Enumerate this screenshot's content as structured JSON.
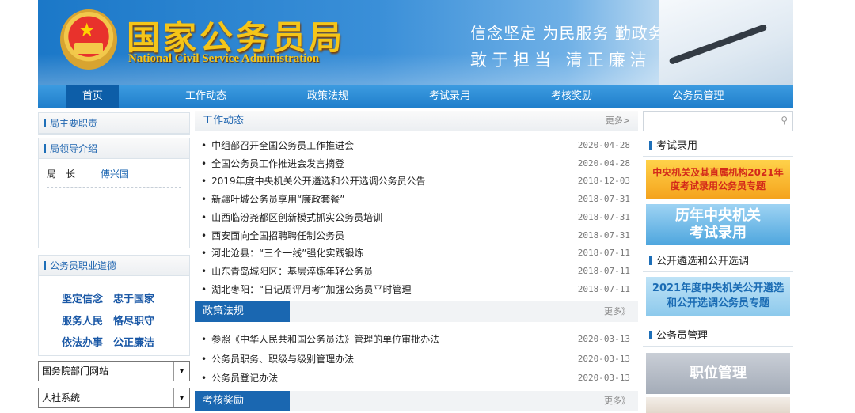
{
  "header": {
    "title": "国家公务员局",
    "subtitle": "National Civil Service Administration",
    "slogan_line1": "信念坚定 为民服务 勤政务实",
    "slogan_line2": "敢于担当  清正廉洁"
  },
  "nav": {
    "items": [
      {
        "label": "首页"
      },
      {
        "label": "工作动态"
      },
      {
        "label": "政策法规"
      },
      {
        "label": "考试录用"
      },
      {
        "label": "考核奖励"
      },
      {
        "label": "公务员管理"
      }
    ]
  },
  "left": {
    "duties_title": "局主要职责",
    "leaders_title": "局领导介绍",
    "leader_role": "局　长",
    "leader_name": "傅兴国",
    "ethics_title": "公务员职业道德",
    "ethics": [
      "坚定信念",
      "忠于国家",
      "服务人民",
      "恪尽职守",
      "依法办事",
      "公正廉洁"
    ],
    "select1": "国务院部门网站",
    "select2": "人社系统"
  },
  "work_news": {
    "title": "工作动态",
    "more": "更多>",
    "items": [
      {
        "title": "中组部召开全国公务员工作推进会",
        "date": "2020-04-28"
      },
      {
        "title": "全国公务员工作推进会发言摘登",
        "date": "2020-04-28"
      },
      {
        "title": "2019年度中央机关公开遴选和公开选调公务员公告",
        "date": "2018-12-03"
      },
      {
        "title": "新疆叶城公务员享用“廉政套餐”",
        "date": "2018-07-31"
      },
      {
        "title": "山西临汾尧都区创新模式抓实公务员培训",
        "date": "2018-07-31"
      },
      {
        "title": "西安面向全国招聘聘任制公务员",
        "date": "2018-07-31"
      },
      {
        "title": "河北沧县：“三个一线”强化实践锻炼",
        "date": "2018-07-11"
      },
      {
        "title": "山东青岛城阳区：基层淬炼年轻公务员",
        "date": "2018-07-11"
      },
      {
        "title": "湖北枣阳：“日记周评月考”加强公务员平时管理",
        "date": "2018-07-11"
      }
    ]
  },
  "policy": {
    "title": "政策法规",
    "more": "更多》",
    "items": [
      {
        "title": "参照《中华人民共和国公务员法》管理的单位审批办法",
        "date": "2020-03-13"
      },
      {
        "title": "公务员职务、职级与级别管理办法",
        "date": "2020-03-13"
      },
      {
        "title": "公务员登记办法",
        "date": "2020-03-13"
      }
    ]
  },
  "reward": {
    "title": "考核奖励",
    "more": "更多》"
  },
  "right": {
    "exam_title": "考试录用",
    "exam_banner1": "中央机关及其直属机构2021年度考试录用公务员专题",
    "exam_banner2_line1": "历年中央机关",
    "exam_banner2_line2": "考试录用",
    "select_title": "公开遴选和公开选调",
    "select_banner": "2021年度中央机关公开遴选和公开选调公务员专题",
    "manage_title": "公务员管理",
    "manage_banner": "职位管理"
  }
}
